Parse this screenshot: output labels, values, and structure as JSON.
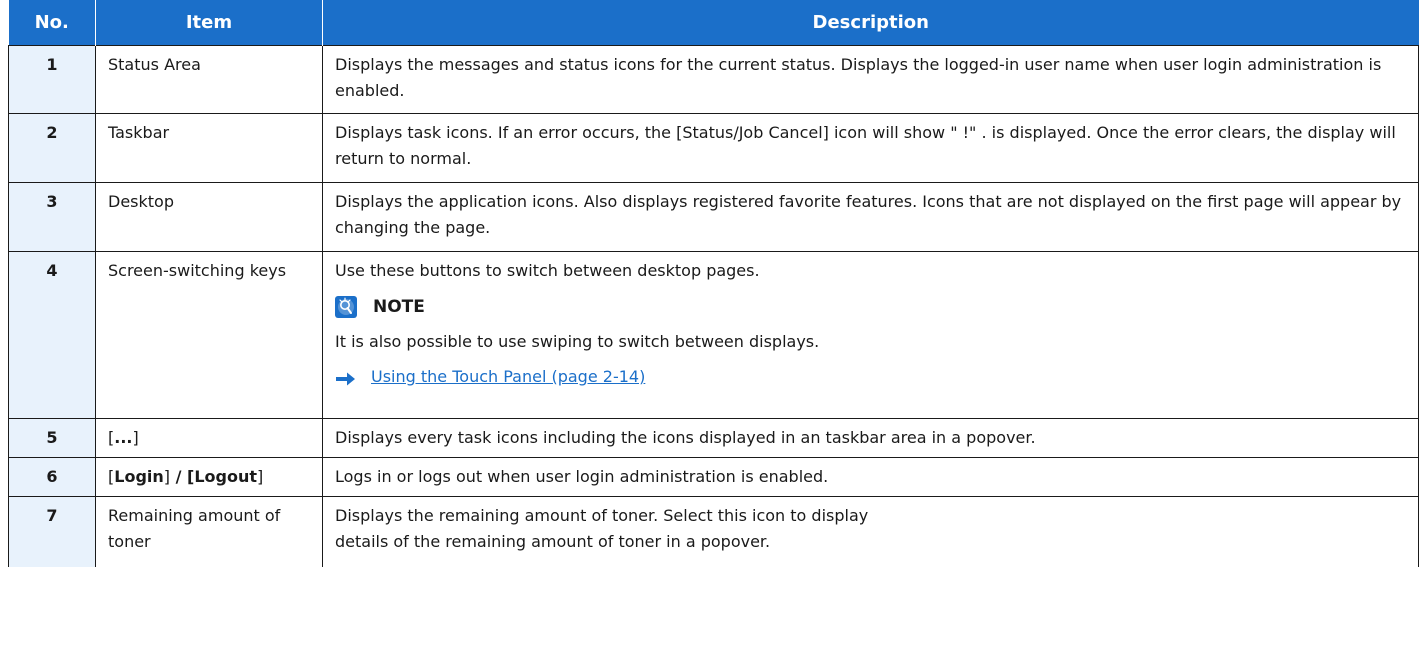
{
  "table": {
    "headers": {
      "no": "No.",
      "item": "Item",
      "description": "Description"
    },
    "rows": [
      {
        "no": "1",
        "item": "Status Area",
        "description": "Displays the messages and status icons for the current status. Displays the logged-in user name when user login administration is enabled."
      },
      {
        "no": "2",
        "item": "Taskbar",
        "description": "Displays task icons. If an error occurs, the [Status/Job Cancel] icon will show \" !\" . is displayed. Once the error clears, the display will return to normal."
      },
      {
        "no": "3",
        "item": "Desktop",
        "description": "Displays the application icons. Also displays registered favorite features. Icons that are not displayed on the first page will appear by changing the page."
      },
      {
        "no": "4",
        "item": "Screen-switching keys",
        "description": "Use these buttons to switch between desktop pages.",
        "note_label": "NOTE",
        "note_text": "It is also possible to use swiping to switch between displays.",
        "link_text": "Using the Touch Panel (page 2-14)"
      },
      {
        "no": "5",
        "item_open": "[",
        "item_bold": "...",
        "item_close": "]",
        "description": "Displays every task icons including the icons displayed in an taskbar area in a popover."
      },
      {
        "no": "6",
        "item_bracket1_open": "[",
        "item_login": "Login",
        "item_bracket1_close": "]",
        "item_sep": " / ",
        "item_bracket2_open": "[",
        "item_logout": "Logout",
        "item_bracket2_close": "]",
        "description": "Logs in or logs out when user login administration is enabled."
      },
      {
        "no": "7",
        "item": "Remaining amount of toner",
        "description_line1": "Displays the remaining amount of toner. Select this icon to display",
        "description_line2": "details of the remaining amount of toner in a popover."
      }
    ]
  },
  "colors": {
    "header_bg": "#1b6fc9",
    "number_cell_bg": "#e8f2fc",
    "link": "#1b6fc9"
  },
  "icons": {
    "note": "note-lightbulb-icon",
    "link_arrow": "right-arrow-icon"
  }
}
